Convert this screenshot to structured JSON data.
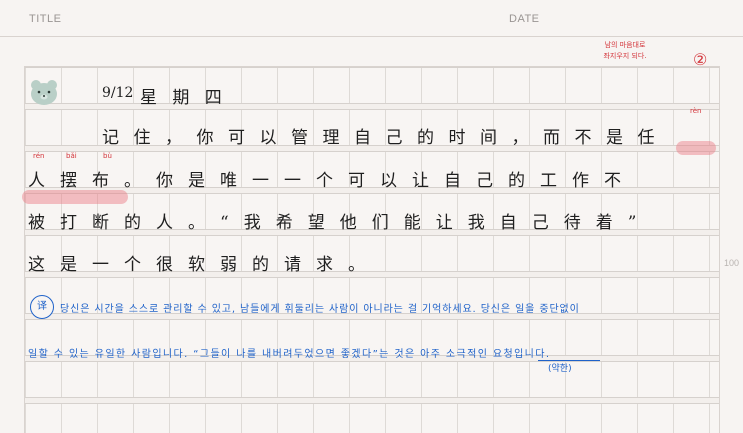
{
  "header": {
    "title_label": "TITLE",
    "date_label": "DATE"
  },
  "side_page_number": "100",
  "line1": {
    "date": "9/12",
    "weekday": "星 期 四"
  },
  "line2": {
    "text": "记住，你可以管理自己的时间，而不是任",
    "pinyin_ren": "rèn",
    "marker": "②"
  },
  "line3": {
    "text": "人摆布。你是唯一一个可以让自己的工作不",
    "pinyin": [
      "rén",
      "bǎi",
      "bù"
    ]
  },
  "line4": {
    "text": "被打断的人。“我希望他们能让我自己待着”"
  },
  "line5": {
    "text": "这是一个很软弱的请求。"
  },
  "red_note": {
    "line1": "남의 마음대로",
    "line2": "좌지우지 되다."
  },
  "translation": {
    "badge": "译",
    "line1": "당신은 시간을 스스로 관리할 수 있고, 남들에게 휘둘리는 사람이 아니라는 걸 기억하세요. 당신은 일을 중단없이",
    "line2": "일할 수 있는 유일한 사람입니다. “그들이 나를 내버려두었으면 좋겠다”는 것은 아주 소극적인 요청입니다.",
    "sub_note": "(약한)"
  }
}
